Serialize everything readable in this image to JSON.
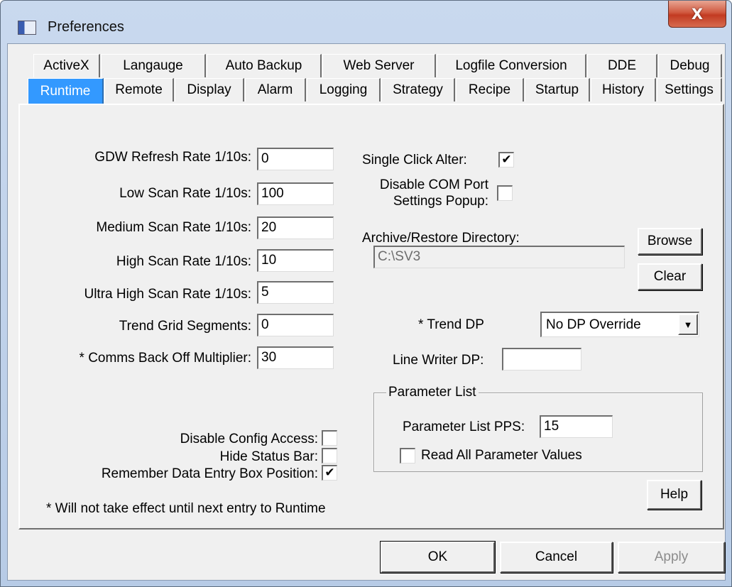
{
  "window": {
    "title": "Preferences",
    "close_glyph": "X",
    "icon": "app-window-icon"
  },
  "tabs": {
    "row1": [
      "ActiveX",
      "Langauge",
      "Auto Backup",
      "Web Server",
      "Logfile Conversion",
      "DDE",
      "Debug"
    ],
    "row2": [
      "Runtime",
      "Remote",
      "Display",
      "Alarm",
      "Logging",
      "Strategy",
      "Recipe",
      "Startup",
      "History",
      "Settings"
    ],
    "active": "Runtime"
  },
  "rates": {
    "gdw_label": "GDW Refresh Rate 1/10s:",
    "gdw_value": "0",
    "low_label": "Low Scan Rate 1/10s:",
    "low_value": "100",
    "medium_label": "Medium Scan Rate 1/10s:",
    "medium_value": "20",
    "high_label": "High Scan Rate 1/10s:",
    "high_value": "10",
    "ultra_label": "Ultra High Scan Rate 1/10s:",
    "ultra_value": "5",
    "trend_grid_label": "Trend Grid Segments:",
    "trend_grid_value": "0",
    "comms_label": "* Comms Back Off Multiplier:",
    "comms_value": "30"
  },
  "options": {
    "single_click_label": "Single Click Alter:",
    "single_click_checked": true,
    "disable_com_label_1": "Disable COM Port",
    "disable_com_label_2": "Settings Popup:",
    "disable_com_checked": false,
    "archive_label": "Archive/Restore Directory:",
    "archive_value": "C:\\SV3",
    "browse_label": "Browse",
    "clear_label": "Clear",
    "trend_dp_label": "* Trend DP",
    "trend_dp_value": "No DP Override",
    "dropdown_glyph": "▼",
    "line_writer_label": "Line Writer DP:",
    "line_writer_value": ""
  },
  "bottom_checks": {
    "disable_config_label": "Disable Config Access:",
    "disable_config_checked": false,
    "hide_status_label": "Hide Status Bar:",
    "hide_status_checked": false,
    "remember_label": "Remember Data Entry Box Position:",
    "remember_checked": true
  },
  "parameter_list": {
    "title": "Parameter List",
    "pps_label": "Parameter List PPS:",
    "pps_value": "15",
    "read_all_label": "Read All Parameter Values",
    "read_all_checked": false
  },
  "footnote": "* Will not take effect until next entry to Runtime",
  "help_label": "Help",
  "buttons": {
    "ok": "OK",
    "cancel": "Cancel",
    "apply": "Apply"
  },
  "check_glyph": "✔"
}
